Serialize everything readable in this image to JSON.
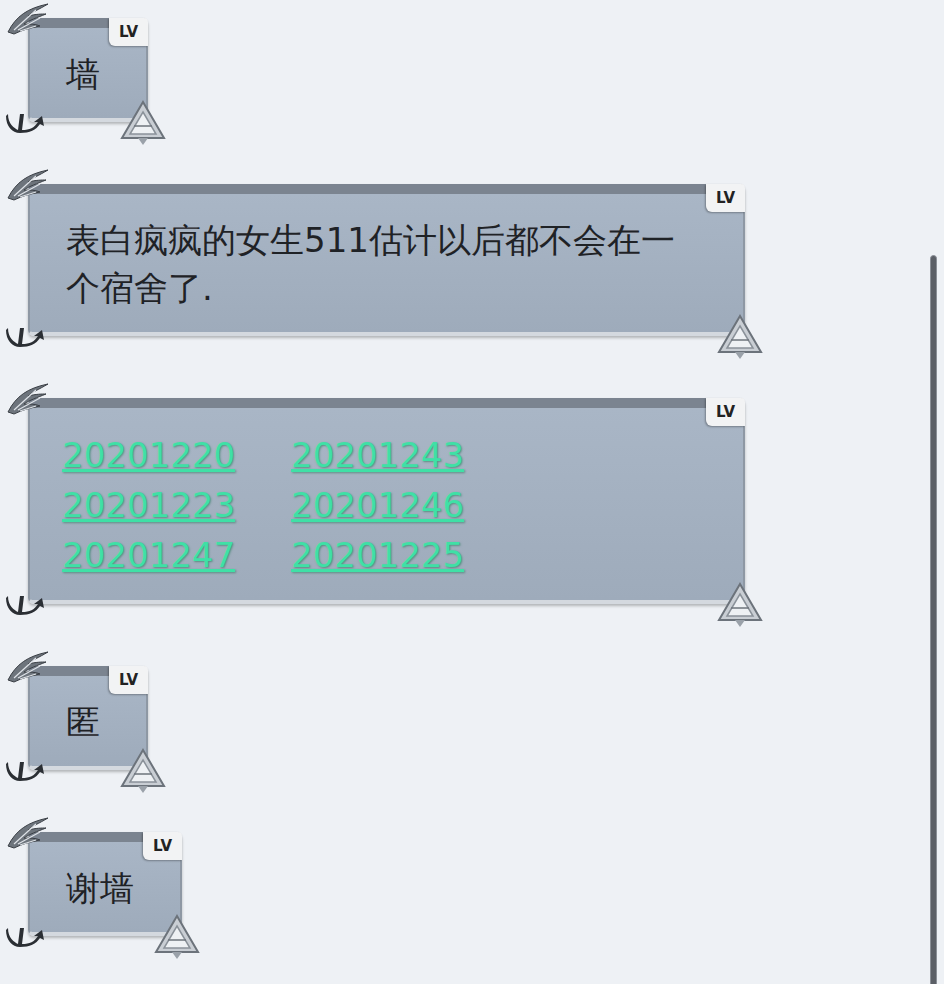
{
  "messages": [
    {
      "kind": "text",
      "text": "墙",
      "badge": "LV"
    },
    {
      "kind": "text",
      "text": "表白疯疯的女生511估计以后都不会在一个宿舍了.",
      "badge": "LV"
    },
    {
      "kind": "links",
      "links": [
        "20201220",
        "20201243",
        "20201223",
        "20201246",
        "20201247",
        "20201225"
      ],
      "badge": "LV"
    },
    {
      "kind": "text",
      "text": "匿",
      "badge": "LV"
    },
    {
      "kind": "text",
      "text": "谢墙",
      "badge": "LV"
    }
  ]
}
